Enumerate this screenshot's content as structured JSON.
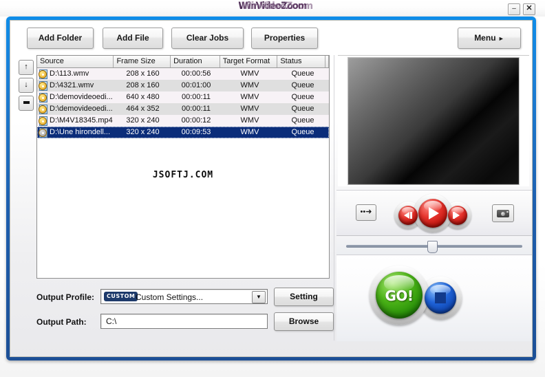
{
  "window": {
    "title": "WinVideoZoom",
    "title_overlay": "WinVideoZoom",
    "minimize_label": "–",
    "close_label": "✕"
  },
  "toolbar": {
    "add_folder": "Add Folder",
    "add_file": "Add File",
    "clear_jobs": "Clear Jobs",
    "properties": "Properties",
    "menu": "Menu",
    "menu_arrow": "►"
  },
  "rail": {
    "move_up": "↑",
    "move_down": "↓",
    "remove": ""
  },
  "job_list": {
    "columns": [
      "Source",
      "Frame Size",
      "Duration",
      "Target Format",
      "Status",
      ""
    ],
    "rows": [
      {
        "source": "D:\\113.wmv",
        "frame_size": "208 x 160",
        "duration": "00:00:56",
        "target_format": "WMV",
        "status": "Queue"
      },
      {
        "source": "D:\\4321.wmv",
        "frame_size": "208 x 160",
        "duration": "00:01:00",
        "target_format": "WMV",
        "status": "Queue"
      },
      {
        "source": "D:\\demovideoedi...",
        "frame_size": "640 x 480",
        "duration": "00:00:11",
        "target_format": "WMV",
        "status": "Queue"
      },
      {
        "source": "D:\\demovideoedi...",
        "frame_size": "464 x 352",
        "duration": "00:00:11",
        "target_format": "WMV",
        "status": "Queue"
      },
      {
        "source": "D:\\M4V18345.mp4",
        "frame_size": "320 x 240",
        "duration": "00:00:12",
        "target_format": "WMV",
        "status": "Queue"
      },
      {
        "source": "D:\\Une hirondell...",
        "frame_size": "320 x 240",
        "duration": "00:09:53",
        "target_format": "WMV",
        "status": "Queue"
      }
    ],
    "selected_index": 5,
    "watermark": "JSOFTJ.COM"
  },
  "output": {
    "profile_label": "Output Profile:",
    "profile_badge": "CUSTOM",
    "profile_value": "Custom Settings...",
    "profile_arrow": "▼",
    "setting_button": "Setting",
    "path_label": "Output Path:",
    "path_value": "C:\\",
    "browse_button": "Browse"
  },
  "player": {
    "skip_icon": "••➜",
    "prev_title": "Previous",
    "play_title": "Play",
    "next_title": "Next",
    "snapshot_title": "Snapshot",
    "seek_position_percent": 50
  },
  "actions": {
    "go_label": "GO!",
    "stop_title": "Stop"
  },
  "colors": {
    "frame_blue": "#1b7fd6",
    "selection_navy": "#0b2d7a",
    "go_green": "#4cb318",
    "stop_blue": "#1f63d8",
    "play_red": "#e5332c",
    "badge_navy": "#1d3a6b"
  }
}
